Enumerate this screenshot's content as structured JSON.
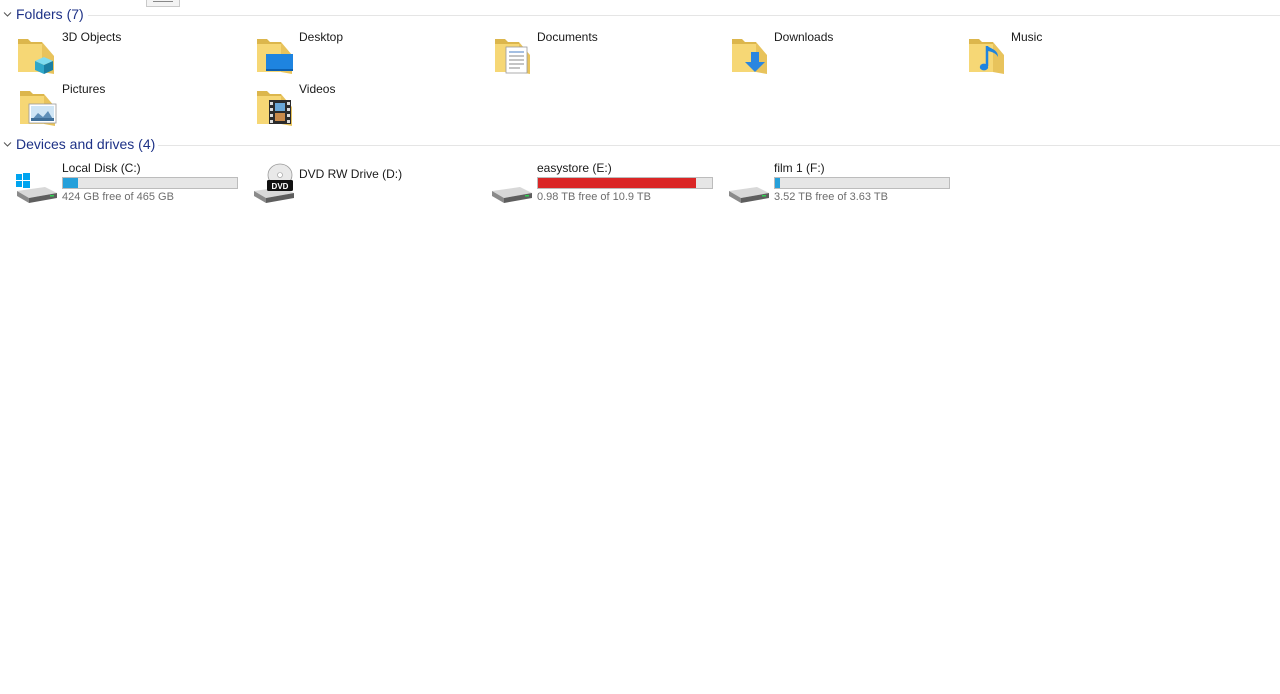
{
  "folders_group": {
    "title": "Folders (7)"
  },
  "folders": [
    {
      "name": "3D Objects",
      "icon": "folder-3d-objects-icon"
    },
    {
      "name": "Desktop",
      "icon": "folder-desktop-icon"
    },
    {
      "name": "Documents",
      "icon": "folder-documents-icon"
    },
    {
      "name": "Downloads",
      "icon": "folder-downloads-icon"
    },
    {
      "name": "Music",
      "icon": "folder-music-icon"
    },
    {
      "name": "Pictures",
      "icon": "folder-pictures-icon"
    },
    {
      "name": "Videos",
      "icon": "folder-videos-icon"
    }
  ],
  "drives_group": {
    "title": "Devices and drives (4)"
  },
  "drives": [
    {
      "name": "Local Disk (C:)",
      "free_text": "424 GB free of 465 GB",
      "used_fraction": 0.088,
      "icon": "windows-drive-icon"
    },
    {
      "name": "DVD RW Drive (D:)",
      "icon": "dvd-drive-icon"
    },
    {
      "name": "easystore (E:)",
      "free_text": "0.98 TB free of 10.9 TB",
      "used_fraction": 0.91,
      "icon": "hard-drive-icon"
    },
    {
      "name": "film 1 (F:)",
      "free_text": "3.52 TB free of 3.63 TB",
      "used_fraction": 0.03,
      "icon": "hard-drive-icon"
    }
  ],
  "colors": {
    "group_header": "#1e3287",
    "bar_normal": "#26a0da",
    "bar_full": "#da2626"
  }
}
